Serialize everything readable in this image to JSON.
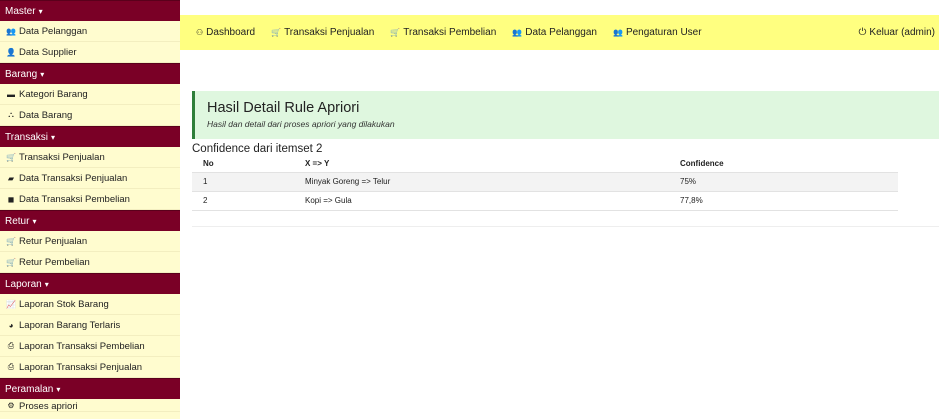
{
  "sidebar": {
    "sections": [
      {
        "title": "Master",
        "items": [
          {
            "icon": "users-icon",
            "glyph": "👥",
            "label": "Data Pelanggan"
          },
          {
            "icon": "user-icon",
            "glyph": "👤",
            "label": "Data Supplier"
          }
        ]
      },
      {
        "title": "Barang",
        "items": [
          {
            "icon": "folder-icon",
            "glyph": "▬",
            "label": "Kategori Barang"
          },
          {
            "icon": "cubes-icon",
            "glyph": "⛬",
            "label": "Data Barang"
          }
        ]
      },
      {
        "title": "Transaksi",
        "items": [
          {
            "icon": "cart-icon",
            "glyph": "🛒",
            "label": "Transaksi Penjualan"
          },
          {
            "icon": "book-icon",
            "glyph": "▰",
            "label": "Data Transaksi Penjualan"
          },
          {
            "icon": "database-icon",
            "glyph": "◼",
            "label": "Data Transaksi Pembelian"
          }
        ]
      },
      {
        "title": "Retur",
        "items": [
          {
            "icon": "cart-icon",
            "glyph": "🛒",
            "label": "Retur Penjualan"
          },
          {
            "icon": "cart-icon",
            "glyph": "🛒",
            "label": "Retur Pembelian"
          }
        ]
      },
      {
        "title": "Laporan",
        "items": [
          {
            "icon": "line-chart-icon",
            "glyph": "📈",
            "label": "Laporan Stok Barang"
          },
          {
            "icon": "pie-chart-icon",
            "glyph": "◕",
            "label": "Laporan Barang Terlaris"
          },
          {
            "icon": "print-icon",
            "glyph": "⎙",
            "label": "Laporan Transaksi Pembelian"
          },
          {
            "icon": "print-icon",
            "glyph": "⎙",
            "label": "Laporan Transaksi Penjualan"
          }
        ]
      },
      {
        "title": "Peramalan",
        "items": [
          {
            "icon": "gear-icon",
            "glyph": "⚙",
            "label": "Proses apriori"
          }
        ]
      }
    ]
  },
  "topbar": {
    "links": [
      {
        "name": "nav-dashboard",
        "icon": "dashboard-icon",
        "glyph": "⚇",
        "label": "Dashboard"
      },
      {
        "name": "nav-transaksi-penjualan",
        "icon": "cart-icon",
        "glyph": "🛒",
        "label": "Transaksi Penjualan"
      },
      {
        "name": "nav-transaksi-pembelian",
        "icon": "cart-icon",
        "glyph": "🛒",
        "label": "Transaksi Pembelian"
      },
      {
        "name": "nav-data-pelanggan",
        "icon": "users-icon",
        "glyph": "👥",
        "label": "Data Pelanggan"
      },
      {
        "name": "nav-pengaturan-user",
        "icon": "users-icon",
        "glyph": "👥",
        "label": "Pengaturan User"
      }
    ],
    "logout": {
      "glyph": "⏻",
      "label": "Keluar (admin)"
    }
  },
  "alert": {
    "title": "Hasil Detail Rule Apriori",
    "subtitle": "Hasil dan detail dari proses apriori yang dilakukan"
  },
  "confidence": {
    "title": "Confidence dari itemset 2",
    "headers": [
      "No",
      "X => Y",
      "Confidence"
    ],
    "rows": [
      [
        "1",
        "Minyak Goreng => Telur",
        "75%"
      ],
      [
        "2",
        "Kopi => Gula",
        "77,8%"
      ]
    ]
  }
}
